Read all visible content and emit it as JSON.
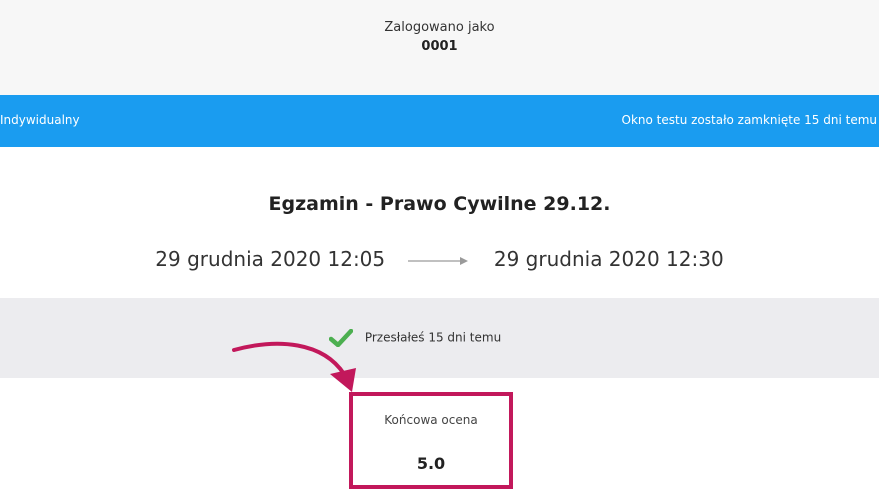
{
  "header": {
    "logged_in_label": "Zalogowano jako",
    "user_id": "0001"
  },
  "bar": {
    "left_text": "Indywidualny",
    "right_text": "Okno testu zostało zamknięte 15 dni temu",
    "color": "#1a9cf0"
  },
  "exam": {
    "title": "Egzamin - Prawo Cywilne 29.12.",
    "start": "29 grudnia 2020 12:05",
    "end": "29 grudnia 2020 12:30"
  },
  "submission": {
    "status_text": "Przesłałeś 15 dni temu",
    "status_icon": "check-icon",
    "status_color": "#4caf50"
  },
  "result": {
    "label": "Końcowa ocena",
    "grade": "5.0",
    "highlight_color": "#c2185b"
  }
}
